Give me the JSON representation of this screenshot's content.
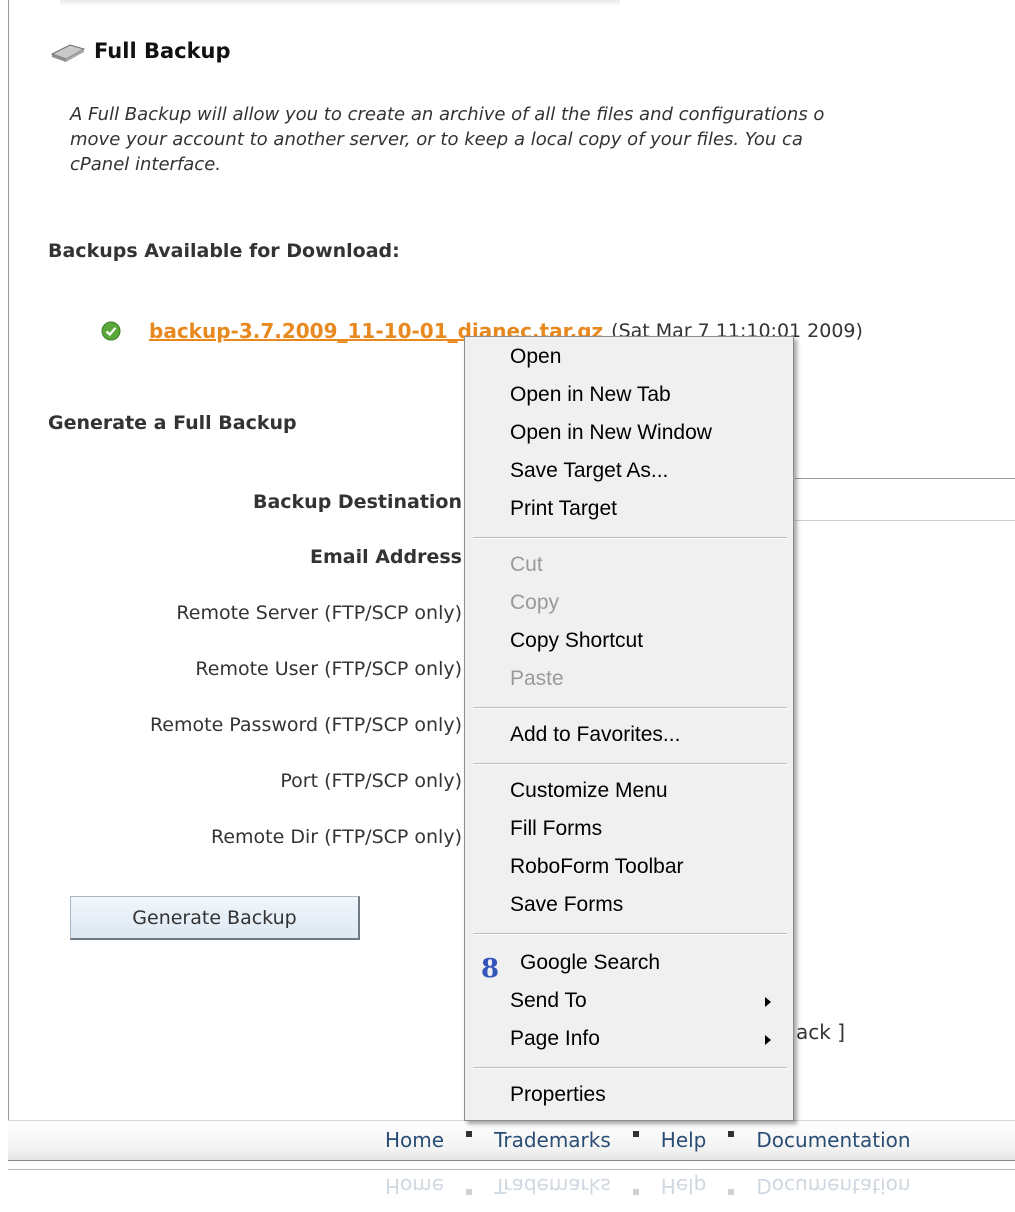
{
  "page": {
    "title": "Full Backup",
    "intro_lines": [
      "A Full Backup will allow you to create an archive of all the files and configurations o",
      "move your account to another server, or to keep a local copy of your files. You ca",
      "cPanel interface."
    ],
    "backups_heading": "Backups Available for Download:",
    "backup_link": "backup-3.7.2009_11-10-01_dianec.tar.gz",
    "backup_date": "(Sat Mar 7 11:10:01 2009)",
    "generate_heading": "Generate a Full Backup",
    "form_labels": {
      "destination": "Backup Destination",
      "email": "Email Address",
      "remote_server": "Remote Server (FTP/SCP only)",
      "remote_user": "Remote User (FTP/SCP only)",
      "remote_password": "Remote Password (FTP/SCP only)",
      "port": "Port (FTP/SCP only)",
      "remote_dir": "Remote Dir (FTP/SCP only)"
    },
    "generate_button": "Generate Backup",
    "go_back": "ack ]"
  },
  "footer": {
    "links": [
      "Home",
      "Trademarks",
      "Help",
      "Documentation"
    ]
  },
  "context_menu": {
    "items": {
      "open": "Open",
      "open_new_tab": "Open in New Tab",
      "open_new_window": "Open in New Window",
      "save_target": "Save Target As...",
      "print_target": "Print Target",
      "cut": "Cut",
      "copy": "Copy",
      "copy_shortcut": "Copy Shortcut",
      "paste": "Paste",
      "add_favorites": "Add to Favorites...",
      "customize_menu": "Customize Menu",
      "fill_forms": "Fill Forms",
      "roboform_toolbar": "RoboForm Toolbar",
      "save_forms": "Save Forms",
      "google_search": "Google Search",
      "send_to": "Send To",
      "page_info": "Page Info",
      "properties": "Properties"
    },
    "google_glyph": "8"
  },
  "icons": {
    "title": "backup-drive-icon",
    "status": "check-circle-icon",
    "submenu": "submenu-arrow-icon",
    "google": "google-icon"
  },
  "colors": {
    "link": "#e8891f",
    "footer_link": "#2a4d75",
    "menu_bg": "#f0f0f0"
  }
}
